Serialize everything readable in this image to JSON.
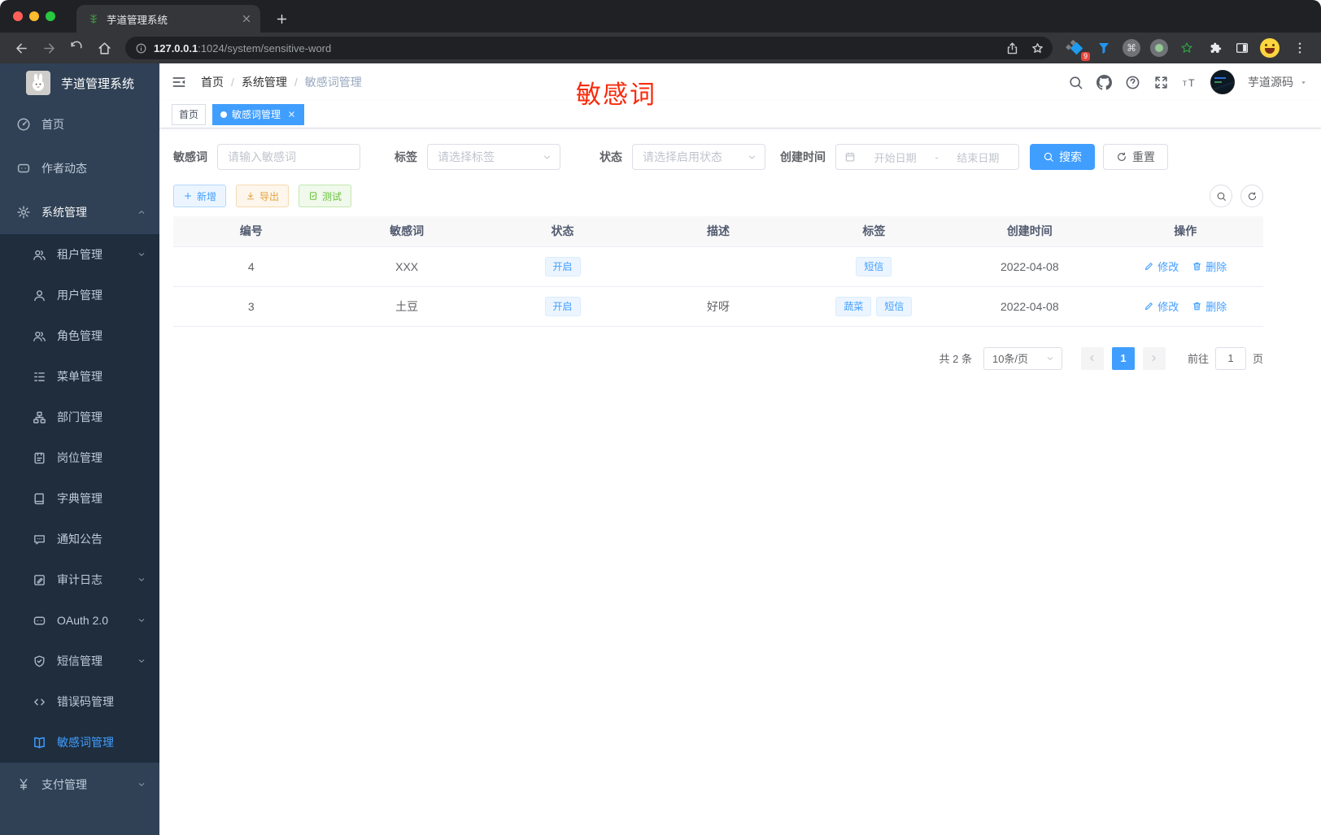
{
  "colors": {
    "accent": "#409eff",
    "annotation_red": "#f82a0c",
    "warning": "#e6a23c",
    "success": "#67c23a"
  },
  "browser": {
    "tab_title": "芋道管理系统",
    "url_host": "127.0.0.1",
    "url_path": ":1024/system/sensitive-word",
    "ext_badge": "9"
  },
  "sidebar": {
    "logo_title": "芋道管理系统",
    "home": "首页",
    "author": "作者动态",
    "system": "系统管理",
    "submenu": [
      "租户管理",
      "用户管理",
      "角色管理",
      "菜单管理",
      "部门管理",
      "岗位管理",
      "字典管理",
      "通知公告",
      "审计日志",
      "OAuth 2.0",
      "短信管理",
      "错误码管理",
      "敏感词管理"
    ],
    "payment": "支付管理"
  },
  "navbar": {
    "breadcrumb": [
      "首页",
      "系统管理",
      "敏感词管理"
    ],
    "sep": "/",
    "username": "芋道源码"
  },
  "annotation": {
    "text": "敏感词"
  },
  "tags_view": {
    "home": "首页",
    "active": "敏感词管理"
  },
  "filters": {
    "keyword_label": "敏感词",
    "keyword_placeholder": "请输入敏感词",
    "tag_label": "标签",
    "tag_placeholder": "请选择标签",
    "status_label": "状态",
    "status_placeholder": "请选择启用状态",
    "date_label": "创建时间",
    "date_start": "开始日期",
    "date_sep": "-",
    "date_end": "结束日期",
    "search": "搜索",
    "reset": "重置"
  },
  "toolbar": {
    "add": "新增",
    "export": "导出",
    "test": "测试"
  },
  "table": {
    "columns": [
      "编号",
      "敏感词",
      "状态",
      "描述",
      "标签",
      "创建时间",
      "操作"
    ],
    "rows": [
      {
        "id": "4",
        "word": "XXX",
        "status": "开启",
        "desc": "",
        "tags": [
          "短信"
        ],
        "created": "2022-04-08",
        "edit": "修改",
        "del": "删除"
      },
      {
        "id": "3",
        "word": "土豆",
        "status": "开启",
        "desc": "好呀",
        "tags": [
          "蔬菜",
          "短信"
        ],
        "created": "2022-04-08",
        "edit": "修改",
        "del": "删除"
      }
    ]
  },
  "pagination": {
    "total": "共 2 条",
    "size": "10条/页",
    "page": "1",
    "goto": "前往",
    "goto_value": "1",
    "unit": "页"
  }
}
